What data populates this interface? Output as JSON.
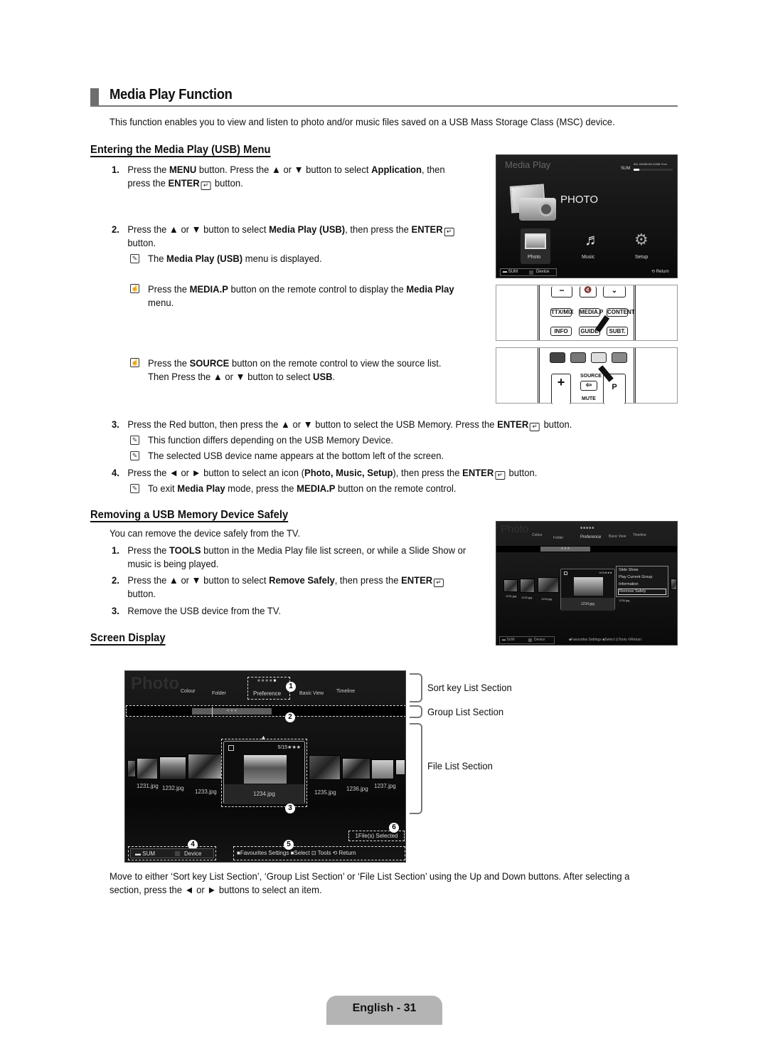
{
  "page": {
    "title": "Media Play Function",
    "intro": "This function enables you to view and listen to photo and/or music files saved on a USB Mass Storage Class (MSC) device.",
    "footer": "English - 31"
  },
  "section_enter": {
    "heading": "Entering the Media Play (USB) Menu",
    "step1": {
      "num": "1.",
      "a": "Press the ",
      "b1": "MENU",
      "c": " button. Press the ▲ or ▼ button to select ",
      "b2": "Application",
      "d": ", then",
      "line2a": "press the ",
      "b3": "ENTER",
      "line2b": " button."
    },
    "step2": {
      "num": "2.",
      "a": "Press the ▲ or ▼ button to select ",
      "b1": "Media Play (USB)",
      "c": ", then press the ",
      "b2": "ENTER",
      "line2": "button."
    },
    "note1": {
      "a": "The ",
      "b": "Media Play (USB)",
      "c": " menu is displayed."
    },
    "note2": {
      "a": "Press the ",
      "b1": "MEDIA.P",
      "c": " button on the remote control to display the ",
      "b2": "Media Play",
      "line2": "menu."
    },
    "note3": {
      "a": "Press the ",
      "b1": "SOURCE",
      "c": " button on the remote control to view the source list.",
      "line2a": "Then Press the ▲ or ▼ button to select ",
      "b2": "USB",
      "line2b": "."
    },
    "step3": {
      "num": "3.",
      "a": "Press the Red button, then press the ▲ or ▼ button to select the USB Memory. Press the ",
      "b": "ENTER",
      "c": " button."
    },
    "note4": "This function differs depending on the USB Memory Device.",
    "note5": "The selected USB device name appears at the bottom left of the screen.",
    "step4": {
      "num": "4.",
      "a": "Press the ◄ or ► button to select an icon (",
      "b": "Photo, Music, Setup",
      "c": "), then press the ",
      "b2": "ENTER",
      "d": " button."
    },
    "note6": {
      "a": "To exit ",
      "b1": "Media Play",
      "c": " mode, press the ",
      "b2": "MEDIA.P",
      "d": " button on the remote control."
    }
  },
  "media_play_screen": {
    "title": "Media Play",
    "device": "SUM",
    "usage": "851.00MB/993.02MB Free",
    "usage_fraction": 0.14,
    "big_label": "PHOTO",
    "icons": [
      {
        "label": "Photo",
        "icon": "photo-icon"
      },
      {
        "label": "Music",
        "icon": "music-note-icon"
      },
      {
        "label": "Setup",
        "icon": "gear-icon"
      }
    ],
    "bottom_device": "SUM",
    "bottom_device_btn": "Device",
    "return": "Return"
  },
  "remote1": {
    "buttons": [
      "TTX/MIX",
      "MEDIA.P",
      "CONTENT",
      "INFO",
      "GUIDE",
      "SUBT."
    ]
  },
  "remote2": {
    "source": "SOURCE",
    "mute": "MUTE",
    "p": "P"
  },
  "section_remove": {
    "heading": "Removing a USB Memory Device Safely",
    "intro": "You can remove the device safely from the TV.",
    "step1": {
      "num": "1.",
      "a": "Press the ",
      "b": "TOOLS",
      "c": " button in the Media Play file list screen, or while a Slide Show or",
      "line2": "music is being played."
    },
    "step2": {
      "num": "2.",
      "a": "Press the ▲ or ▼ button to select ",
      "b1": "Remove Safely",
      "c": ", then press the ",
      "b2": "ENTER",
      "line2": "button."
    },
    "step3": {
      "num": "3.",
      "text": "Remove the USB device from the TV."
    }
  },
  "tools_screen": {
    "title": "Photo",
    "sort_keys": [
      "Colour",
      "Folder",
      "Preference",
      "Basic View",
      "Timeline"
    ],
    "rating": "5/15",
    "menu": [
      "Slide Show",
      "Play Current Group",
      "Information",
      "Remove Safely"
    ],
    "selected_menu": "Remove Safely",
    "files": [
      "1231.jpg",
      "1232.jpg",
      "1233.jpg",
      "1234.jpg",
      "1235.jpg"
    ],
    "device": "SUM",
    "device_btn": "Device",
    "bottom": [
      "Favourites Settings",
      "Select",
      "Tools",
      "Return"
    ]
  },
  "section_screen": {
    "heading": "Screen Display",
    "screen": {
      "title": "Photo",
      "sort_keys": [
        "Colour",
        "Folder",
        "Preference",
        "Basic View",
        "Timeline"
      ],
      "group": "★★★",
      "rating": "5/15★★★",
      "files": [
        "1231.jpg",
        "1232.jpg",
        "1233.jpg",
        "1234.jpg",
        "1235.jpg",
        "1236.jpg",
        "1237.jpg"
      ],
      "selected_file": "1234.jpg",
      "selected_count": "1File(s) Selected",
      "device": "SUM",
      "device_btn": "Device",
      "bottom": [
        "Favourites Settings",
        "Select",
        "Tools",
        "Return"
      ],
      "callouts": [
        "1",
        "2",
        "3",
        "4",
        "5",
        "6"
      ]
    },
    "labels": [
      "Sort key List Section",
      "Group List Section",
      "File List Section"
    ],
    "desc1": "Move to either ‘Sort key List Section’, ‘Group List Section’ or ‘File List Section’ using the Up and Down buttons. After selecting a",
    "desc2": "section, press the ◄ or ► buttons to select an item."
  }
}
